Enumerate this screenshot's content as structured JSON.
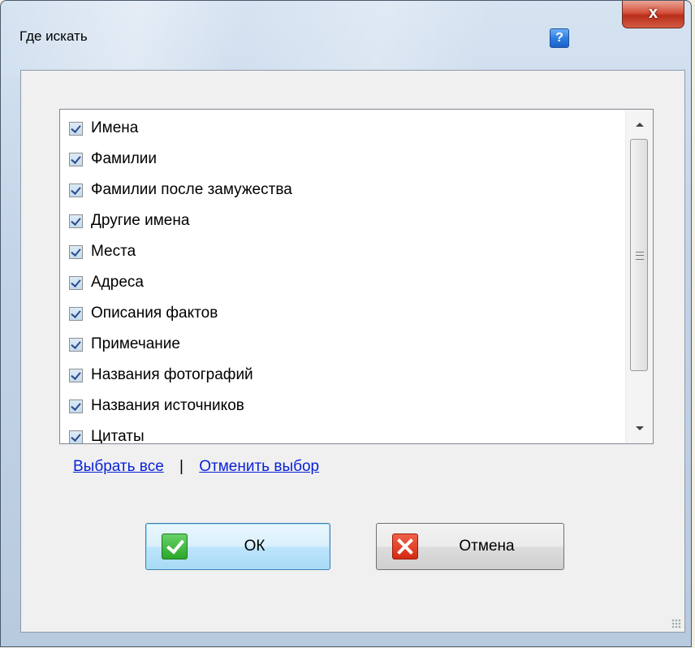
{
  "window": {
    "title": "Где искать",
    "help_glyph": "?",
    "close_glyph": "x"
  },
  "list": {
    "items": [
      {
        "label": "Имена",
        "checked": true
      },
      {
        "label": "Фамилии",
        "checked": true
      },
      {
        "label": "Фамилии после замужества",
        "checked": true
      },
      {
        "label": "Другие имена",
        "checked": true
      },
      {
        "label": "Места",
        "checked": true
      },
      {
        "label": "Адреса",
        "checked": true
      },
      {
        "label": "Описания фактов",
        "checked": true
      },
      {
        "label": "Примечание",
        "checked": true
      },
      {
        "label": "Названия фотографий",
        "checked": true
      },
      {
        "label": "Названия источников",
        "checked": true
      },
      {
        "label": "Цитаты",
        "checked": true
      }
    ]
  },
  "links": {
    "select_all": "Выбрать все",
    "separator": "|",
    "deselect": "Отменить выбор"
  },
  "buttons": {
    "ok": "ОК",
    "cancel": "Отмена"
  },
  "icons": {
    "ok": "green-check-icon",
    "cancel": "red-x-icon",
    "help": "help-icon",
    "close": "close-icon"
  }
}
